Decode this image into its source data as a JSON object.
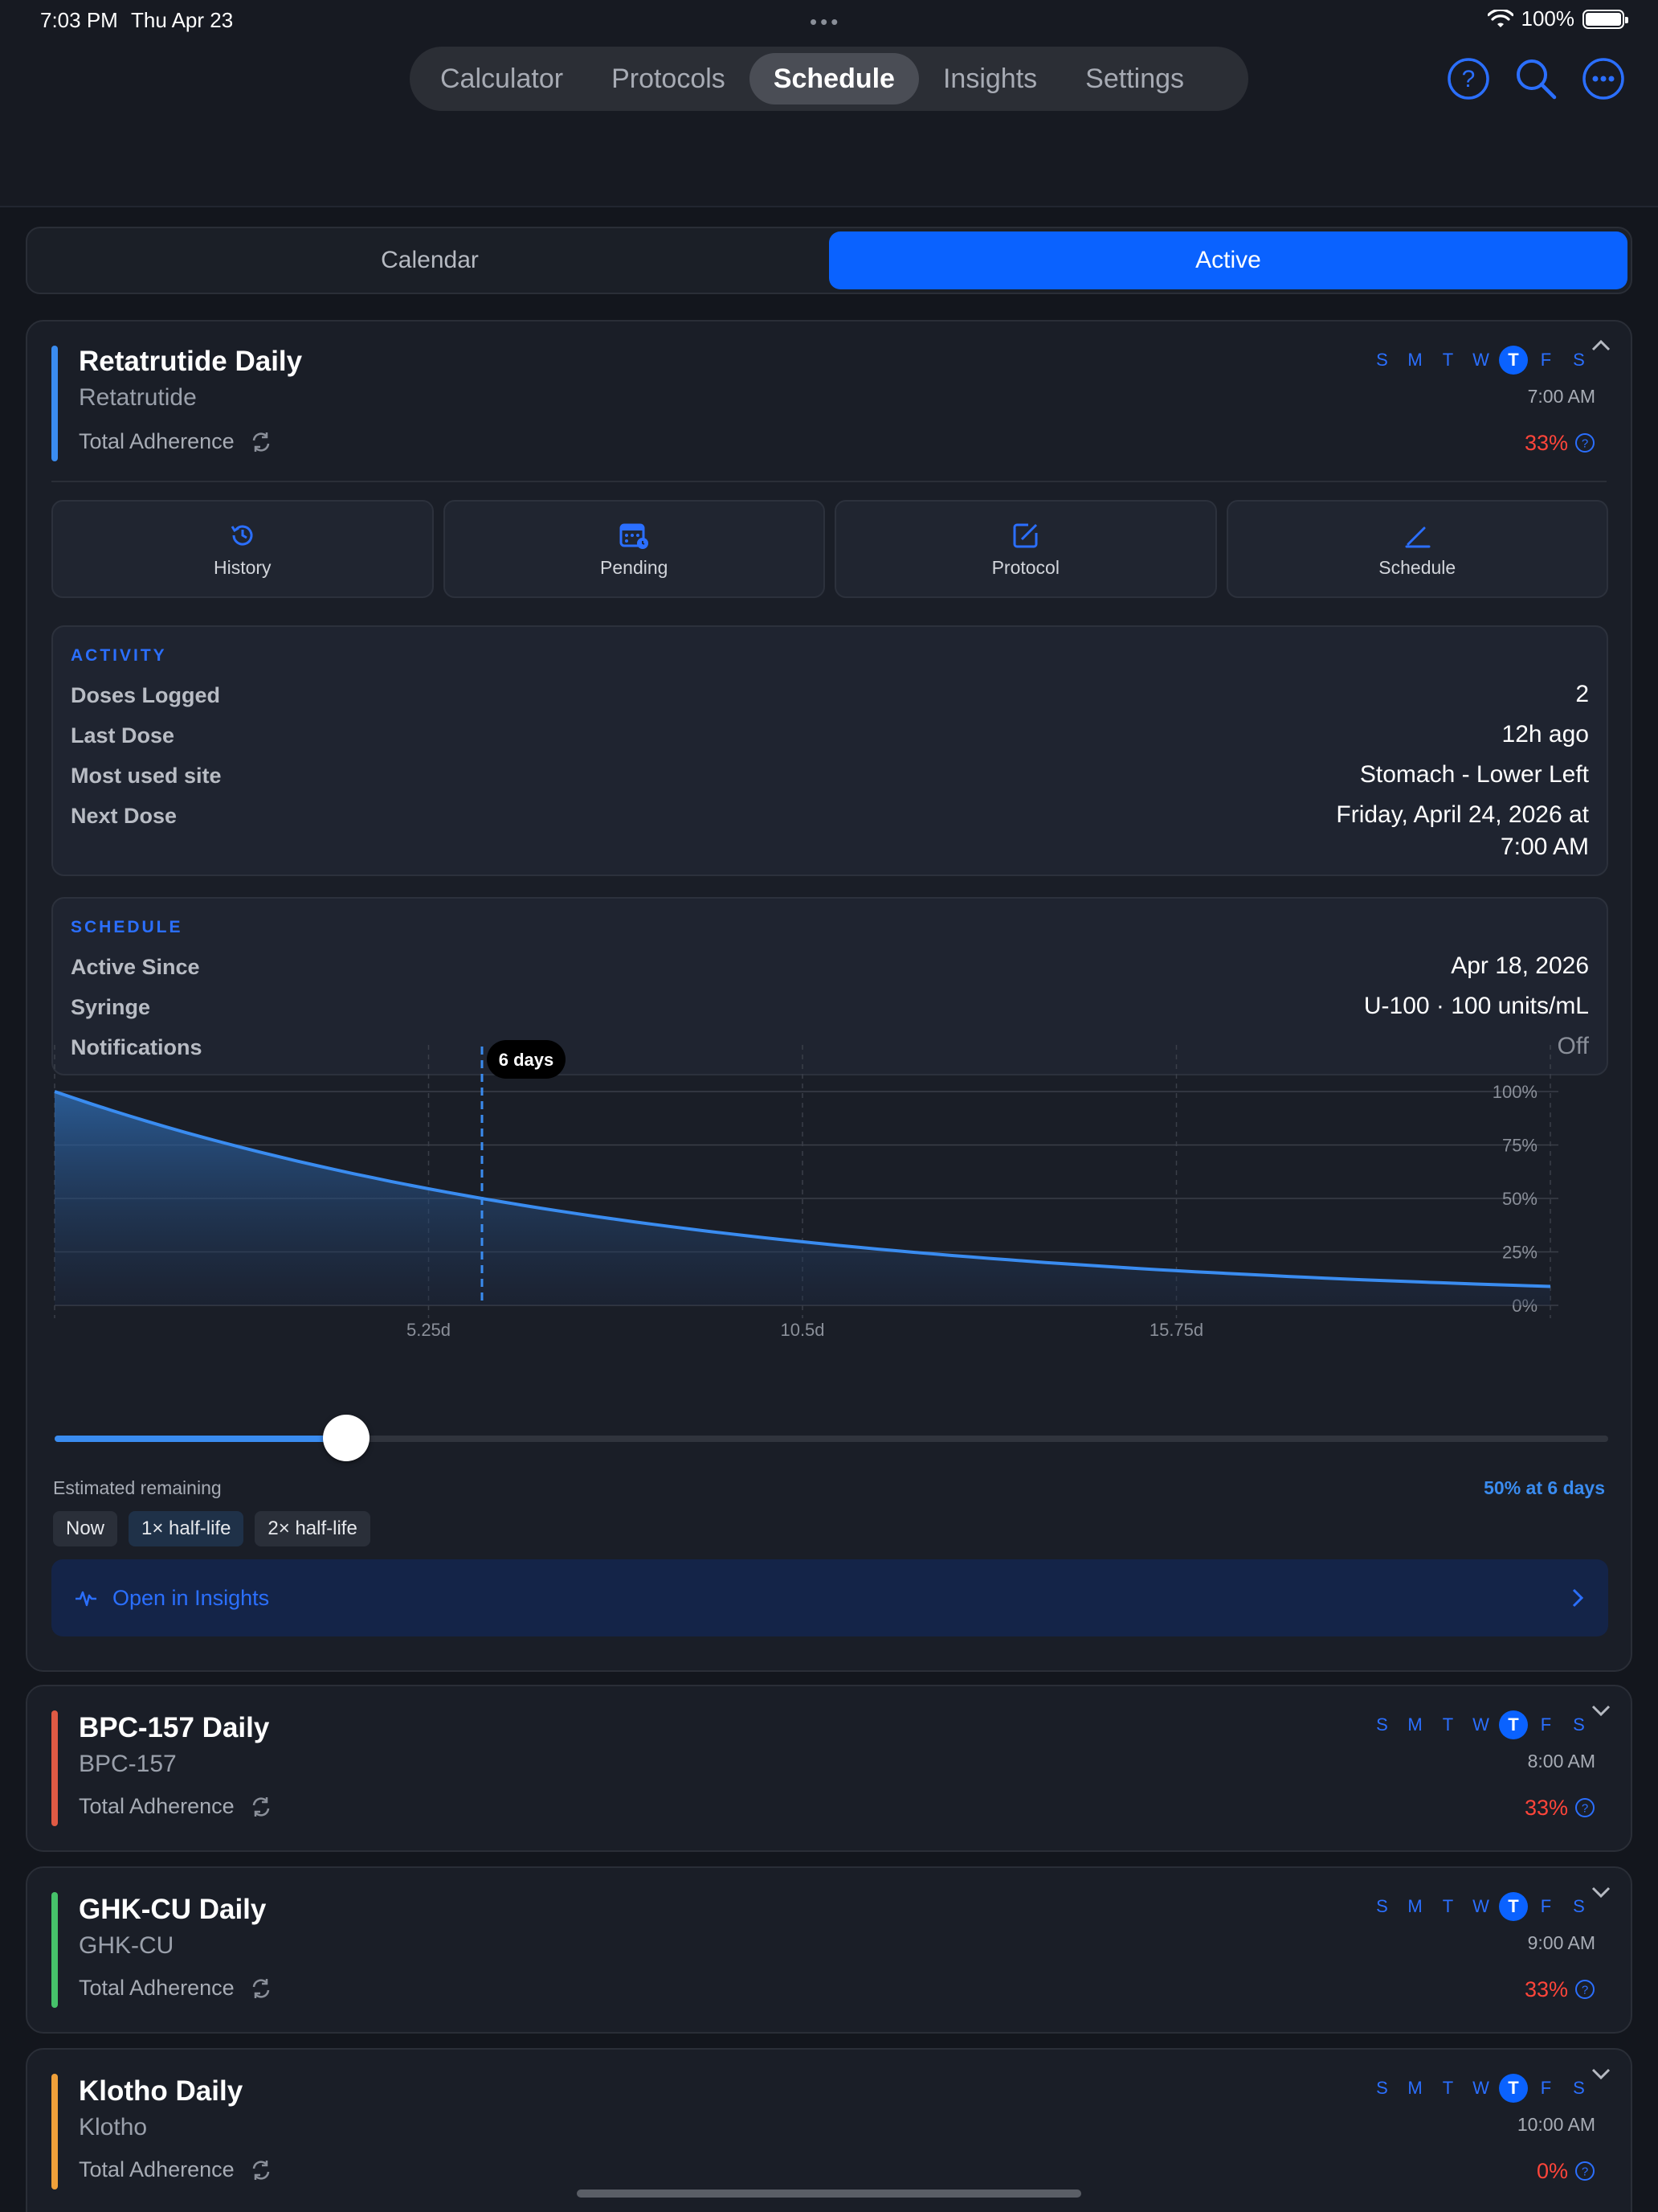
{
  "status_bar": {
    "time": "7:03 PM",
    "date": "Thu Apr 23",
    "battery": "100%"
  },
  "nav": {
    "tabs": [
      "Calculator",
      "Protocols",
      "Schedule",
      "Insights",
      "Settings"
    ],
    "active": "Schedule",
    "icons": [
      "help-icon",
      "search-icon",
      "more-icon"
    ]
  },
  "segmented": {
    "left": "Calendar",
    "right": "Active",
    "active": "Active"
  },
  "days": [
    "S",
    "M",
    "T",
    "W",
    "T",
    "F",
    "S"
  ],
  "protocols": [
    {
      "title": "Retatrutide Daily",
      "compound": "Retatrutide",
      "adherence_label": "Total Adherence",
      "time": "7:00 AM",
      "adherence": "33%",
      "color": "#3a8cf0",
      "expanded": true
    },
    {
      "title": "BPC-157 Daily",
      "compound": "BPC-157",
      "adherence_label": "Total Adherence",
      "time": "8:00 AM",
      "adherence": "33%",
      "color": "#e05a44",
      "expanded": false
    },
    {
      "title": "GHK-CU Daily",
      "compound": "GHK-CU",
      "adherence_label": "Total Adherence",
      "time": "9:00 AM",
      "adherence": "33%",
      "color": "#46c26a",
      "expanded": false
    },
    {
      "title": "Klotho Daily",
      "compound": "Klotho",
      "adherence_label": "Total Adherence",
      "time": "10:00 AM",
      "adherence": "0%",
      "color": "#f0a03a",
      "expanded": false
    }
  ],
  "actions": [
    {
      "label": "History",
      "icon": "history-icon"
    },
    {
      "label": "Pending",
      "icon": "calendar-pending-icon"
    },
    {
      "label": "Protocol",
      "icon": "edit-icon"
    },
    {
      "label": "Schedule",
      "icon": "pencil-icon"
    }
  ],
  "activity": {
    "title": "ACTIVITY",
    "rows": [
      {
        "key": "Doses Logged",
        "value": "2"
      },
      {
        "key": "Last Dose",
        "value": "12h ago"
      },
      {
        "key": "Most used site",
        "value": "Stomach - Lower Left"
      },
      {
        "key": "Next Dose",
        "value_line1": "Friday, April 24, 2026 at",
        "value_line2": "7:00 AM"
      }
    ]
  },
  "schedule": {
    "title": "SCHEDULE",
    "rows": [
      {
        "key": "Active Since",
        "value": "Apr 18, 2026"
      },
      {
        "key": "Syringe",
        "value": "U-100 · 100 units/mL"
      },
      {
        "key": "Notifications",
        "value": "Off"
      }
    ]
  },
  "chart_data": {
    "type": "area",
    "x_ticks": [
      "5.25d",
      "10.5d",
      "15.75d"
    ],
    "x_tick_values": [
      5.25,
      10.5,
      15.75
    ],
    "xlim": [
      0,
      21
    ],
    "y_ticks": [
      "100%",
      "75%",
      "50%",
      "25%",
      "0%"
    ],
    "ylim": [
      0,
      100
    ],
    "half_life_days": 6,
    "x": [
      0,
      3,
      6,
      9,
      12,
      15,
      18,
      21
    ],
    "values": [
      100,
      70.7,
      50,
      35.4,
      25,
      17.7,
      12.5,
      8.8
    ],
    "marker_x": 6,
    "marker_label": "6 days"
  },
  "slider": {
    "value_days": 6,
    "max_days": 21
  },
  "estimate": {
    "label": "Estimated remaining",
    "value": "50% at 6 days"
  },
  "chips": [
    "Now",
    "1× half-life",
    "2× half-life"
  ],
  "insights_link": "Open in Insights"
}
